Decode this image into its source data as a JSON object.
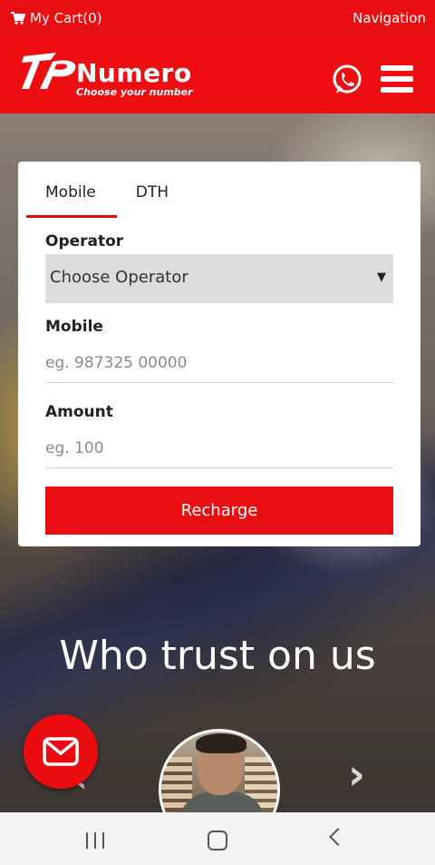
{
  "topbar": {
    "cart_label": "My Cart(0)",
    "nav_label": "Navigation"
  },
  "brand": {
    "name": "Numero",
    "tagline": "Choose your number"
  },
  "form": {
    "tabs": [
      {
        "label": "Mobile",
        "active": true
      },
      {
        "label": "DTH",
        "active": false
      }
    ],
    "operator_label": "Operator",
    "operator_selected": "Choose Operator",
    "mobile_label": "Mobile",
    "mobile_placeholder": "eg. 987325 00000",
    "amount_label": "Amount",
    "amount_placeholder": "eg. 100",
    "submit_label": "Recharge"
  },
  "testimonials": {
    "heading": "Who trust on us"
  },
  "colors": {
    "brand_red": "#e90e12",
    "white": "#ffffff"
  },
  "icons": [
    "cart-icon",
    "logo-icon",
    "whatsapp-icon",
    "menu-icon",
    "mail-icon",
    "chevron-left-icon",
    "chevron-right-icon"
  ]
}
